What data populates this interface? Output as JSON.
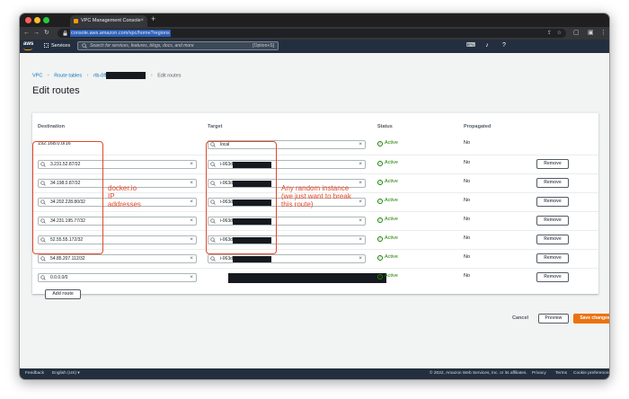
{
  "browser": {
    "tab_title": "VPC Management Console",
    "url": "console.aws.amazon.com/vpc/home?regions"
  },
  "aws": {
    "logo": "aws",
    "services_label": "Services",
    "search_placeholder": "Search for services, features, blogs, docs, and more",
    "search_shortcut": "[Option+S]"
  },
  "breadcrumb": {
    "vpc": "VPC",
    "route_tables": "Route tables",
    "route_table_id": "rtb-0ff",
    "current": "Edit routes"
  },
  "page_title": "Edit routes",
  "table": {
    "columns": [
      "Destination",
      "Target",
      "Status",
      "Propagated"
    ],
    "rows": [
      {
        "destination": "192.168.0.0/16",
        "target": "local",
        "status": "Active",
        "propagated": "No"
      },
      {
        "destination": "3.231.52.87/32",
        "target": "i-063d",
        "status": "Active",
        "propagated": "No"
      },
      {
        "destination": "34.198.0.87/32",
        "target": "i-063d",
        "status": "Active",
        "propagated": "No"
      },
      {
        "destination": "34.202.228.80/32",
        "target": "i-063d",
        "status": "Active",
        "propagated": "No"
      },
      {
        "destination": "34.231.195.77/32",
        "target": "i-063d",
        "status": "Active",
        "propagated": "No"
      },
      {
        "destination": "52.55.55.172/32",
        "target": "i-063d",
        "status": "Active",
        "propagated": "No"
      },
      {
        "destination": "54.85.207.112/32",
        "target": "i-063d",
        "status": "Active",
        "propagated": "No"
      },
      {
        "destination": "0.0.0.0/0",
        "target": "",
        "status": "Active",
        "propagated": "No"
      }
    ],
    "remove_label": "Remove",
    "add_route_label": "Add route"
  },
  "annotations": {
    "destinations_note": "docker.io\nIP\naddresses",
    "targets_note": "Any random instance\n(we just want to break\nthis route)"
  },
  "actions": {
    "cancel": "Cancel",
    "preview": "Preview",
    "save": "Save changes"
  },
  "footer": {
    "feedback": "Feedback",
    "language": "English (US) ▾",
    "copyright": "© 2022, Amazon Web Services, Inc. or its affiliates.",
    "privacy": "Privacy",
    "terms": "Terms",
    "cookies": "Cookie preferences"
  },
  "colors": {
    "aws_nav": "#232f3e",
    "link": "#0073bb",
    "active_status": "#1d8102",
    "primary_button": "#ec7211",
    "annotation": "#e0492a"
  }
}
